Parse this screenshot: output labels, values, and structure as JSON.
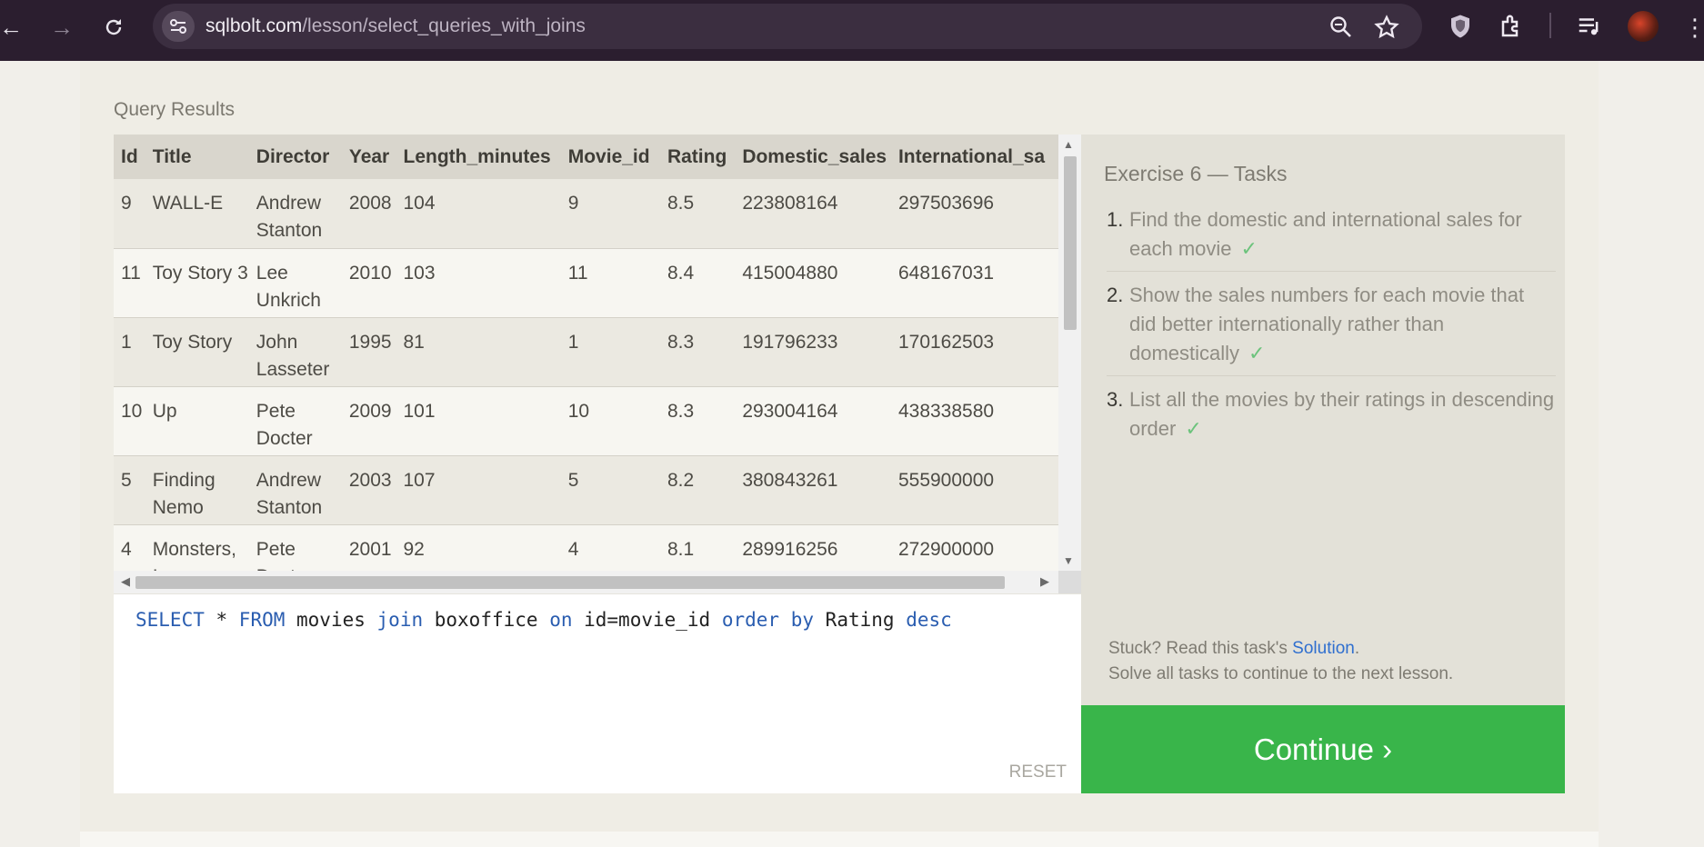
{
  "browser": {
    "url_host": "sqlbolt.com",
    "url_path": "/lesson/select_queries_with_joins"
  },
  "results": {
    "label": "Query Results",
    "columns": [
      "Id",
      "Title",
      "Director",
      "Year",
      "Length_minutes",
      "Movie_id",
      "Rating",
      "Domestic_sales",
      "International_sa"
    ],
    "rows": [
      [
        "9",
        "WALL-E",
        "Andrew Stanton",
        "2008",
        "104",
        "9",
        "8.5",
        "223808164",
        "297503696"
      ],
      [
        "11",
        "Toy Story 3",
        "Lee Unkrich",
        "2010",
        "103",
        "11",
        "8.4",
        "415004880",
        "648167031"
      ],
      [
        "1",
        "Toy Story",
        "John Lasseter",
        "1995",
        "81",
        "1",
        "8.3",
        "191796233",
        "170162503"
      ],
      [
        "10",
        "Up",
        "Pete Docter",
        "2009",
        "101",
        "10",
        "8.3",
        "293004164",
        "438338580"
      ],
      [
        "5",
        "Finding Nemo",
        "Andrew Stanton",
        "2003",
        "107",
        "5",
        "8.2",
        "380843261",
        "555900000"
      ],
      [
        "4",
        "Monsters, Inc.",
        "Pete Docter",
        "2001",
        "92",
        "4",
        "8.1",
        "289916256",
        "272900000"
      ]
    ]
  },
  "editor": {
    "tokens": [
      {
        "t": "SELECT",
        "kw": true
      },
      {
        "t": " * ",
        "kw": false
      },
      {
        "t": "FROM",
        "kw": true
      },
      {
        "t": " movies ",
        "kw": false
      },
      {
        "t": "join",
        "kw": true
      },
      {
        "t": " boxoffice ",
        "kw": false
      },
      {
        "t": "on",
        "kw": true
      },
      {
        "t": " id=movie_id ",
        "kw": false
      },
      {
        "t": "order",
        "kw": true
      },
      {
        "t": " ",
        "kw": false
      },
      {
        "t": "by",
        "kw": true
      },
      {
        "t": " Rating ",
        "kw": false
      },
      {
        "t": "desc",
        "kw": true
      }
    ],
    "reset_label": "RESET"
  },
  "tasks": {
    "title": "Exercise 6 — Tasks",
    "items": [
      {
        "num": "1.",
        "text": "Find the domestic and international sales for each movie",
        "check": "✓"
      },
      {
        "num": "2.",
        "text": "Show the sales numbers for each movie that did better internationally rather than domestically",
        "check": "✓"
      },
      {
        "num": "3.",
        "text": "List all the movies by their ratings in descending order",
        "check": "✓"
      }
    ],
    "stuck_prefix": "Stuck? Read this task's ",
    "solution_label": "Solution",
    "stuck_suffix": ".",
    "hint": "Solve all tasks to continue to the next lesson."
  },
  "continue_label": "Continue ›",
  "colors": {
    "continue_bg": "#39b54a",
    "keyword": "#2a5db0",
    "check": "#6cc37c",
    "link": "#2f6fcf"
  }
}
